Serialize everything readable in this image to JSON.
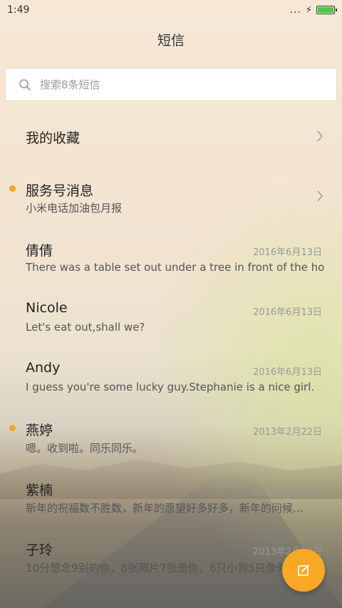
{
  "status_bar": {
    "time": "1:49",
    "signal_dots": "...",
    "charging": "⚡"
  },
  "header": {
    "title": "短信"
  },
  "search": {
    "placeholder": "搜索8条短信"
  },
  "favorites": {
    "label": "我的收藏"
  },
  "service": {
    "name": "服务号消息",
    "preview": "小米电话加油包月报",
    "unread": true
  },
  "threads": [
    {
      "name": "倩倩",
      "date": "2016年6月13日",
      "preview": "There was a table set out under a tree in front of the ho...",
      "unread": false
    },
    {
      "name": "Nicole",
      "date": "2016年6月13日",
      "preview": "Let's eat out,shall we?",
      "unread": false
    },
    {
      "name": "Andy",
      "date": "2016年6月13日",
      "preview": "I guess you're some lucky guy.Stephanie is a nice girl.",
      "unread": false
    },
    {
      "name": "燕婷",
      "date": "2013年2月22日",
      "preview": "嗯。收到啦。同乐同乐。",
      "unread": true
    },
    {
      "name": "紫楠",
      "date": "2013年2月22日",
      "preview": "新年的祝福数不胜数，新年的愿望好多好多，新年的问候...",
      "unread": false
    },
    {
      "name": "子玲",
      "date": "2013年2月22日",
      "preview": "10分想念9别的你，8张照片7张是你，6只小狗5只像你...",
      "unread": false
    }
  ],
  "colors": {
    "accent": "#f9a825",
    "unread_dot": "#f5a623",
    "battery": "#3fcf3f"
  },
  "icons": {
    "search": "search-icon",
    "chevron": "chevron-right-icon",
    "compose": "compose-icon"
  }
}
